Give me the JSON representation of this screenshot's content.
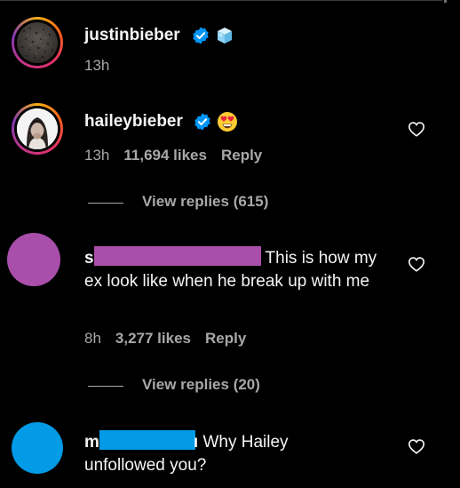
{
  "colors": {
    "background": "#000000",
    "text": "#f5f5f5",
    "muted": "#a8a8a8",
    "verified": "#0095f6",
    "redact_purple": "#a94eaa",
    "redact_blue": "#039be5"
  },
  "comments": [
    {
      "username": "justinbieber",
      "verified": true,
      "badge_icon": "ice-cube-emoji-icon",
      "time": "13h"
    },
    {
      "username": "haileybieber",
      "verified": true,
      "badge_icon": "heart-eyes-emoji-icon",
      "time": "13h",
      "likes": "11,694 likes",
      "reply_label": "Reply",
      "view_replies": "View replies (615)"
    },
    {
      "username_visible": "s",
      "text": "This is how my ex look like when he break up with me",
      "time": "8h",
      "likes": "3,277 likes",
      "reply_label": "Reply",
      "view_replies": "View replies (20)"
    },
    {
      "username_visible": "m",
      "username_tail": "ı",
      "text": "Why Hailey unfollowed you?"
    }
  ]
}
